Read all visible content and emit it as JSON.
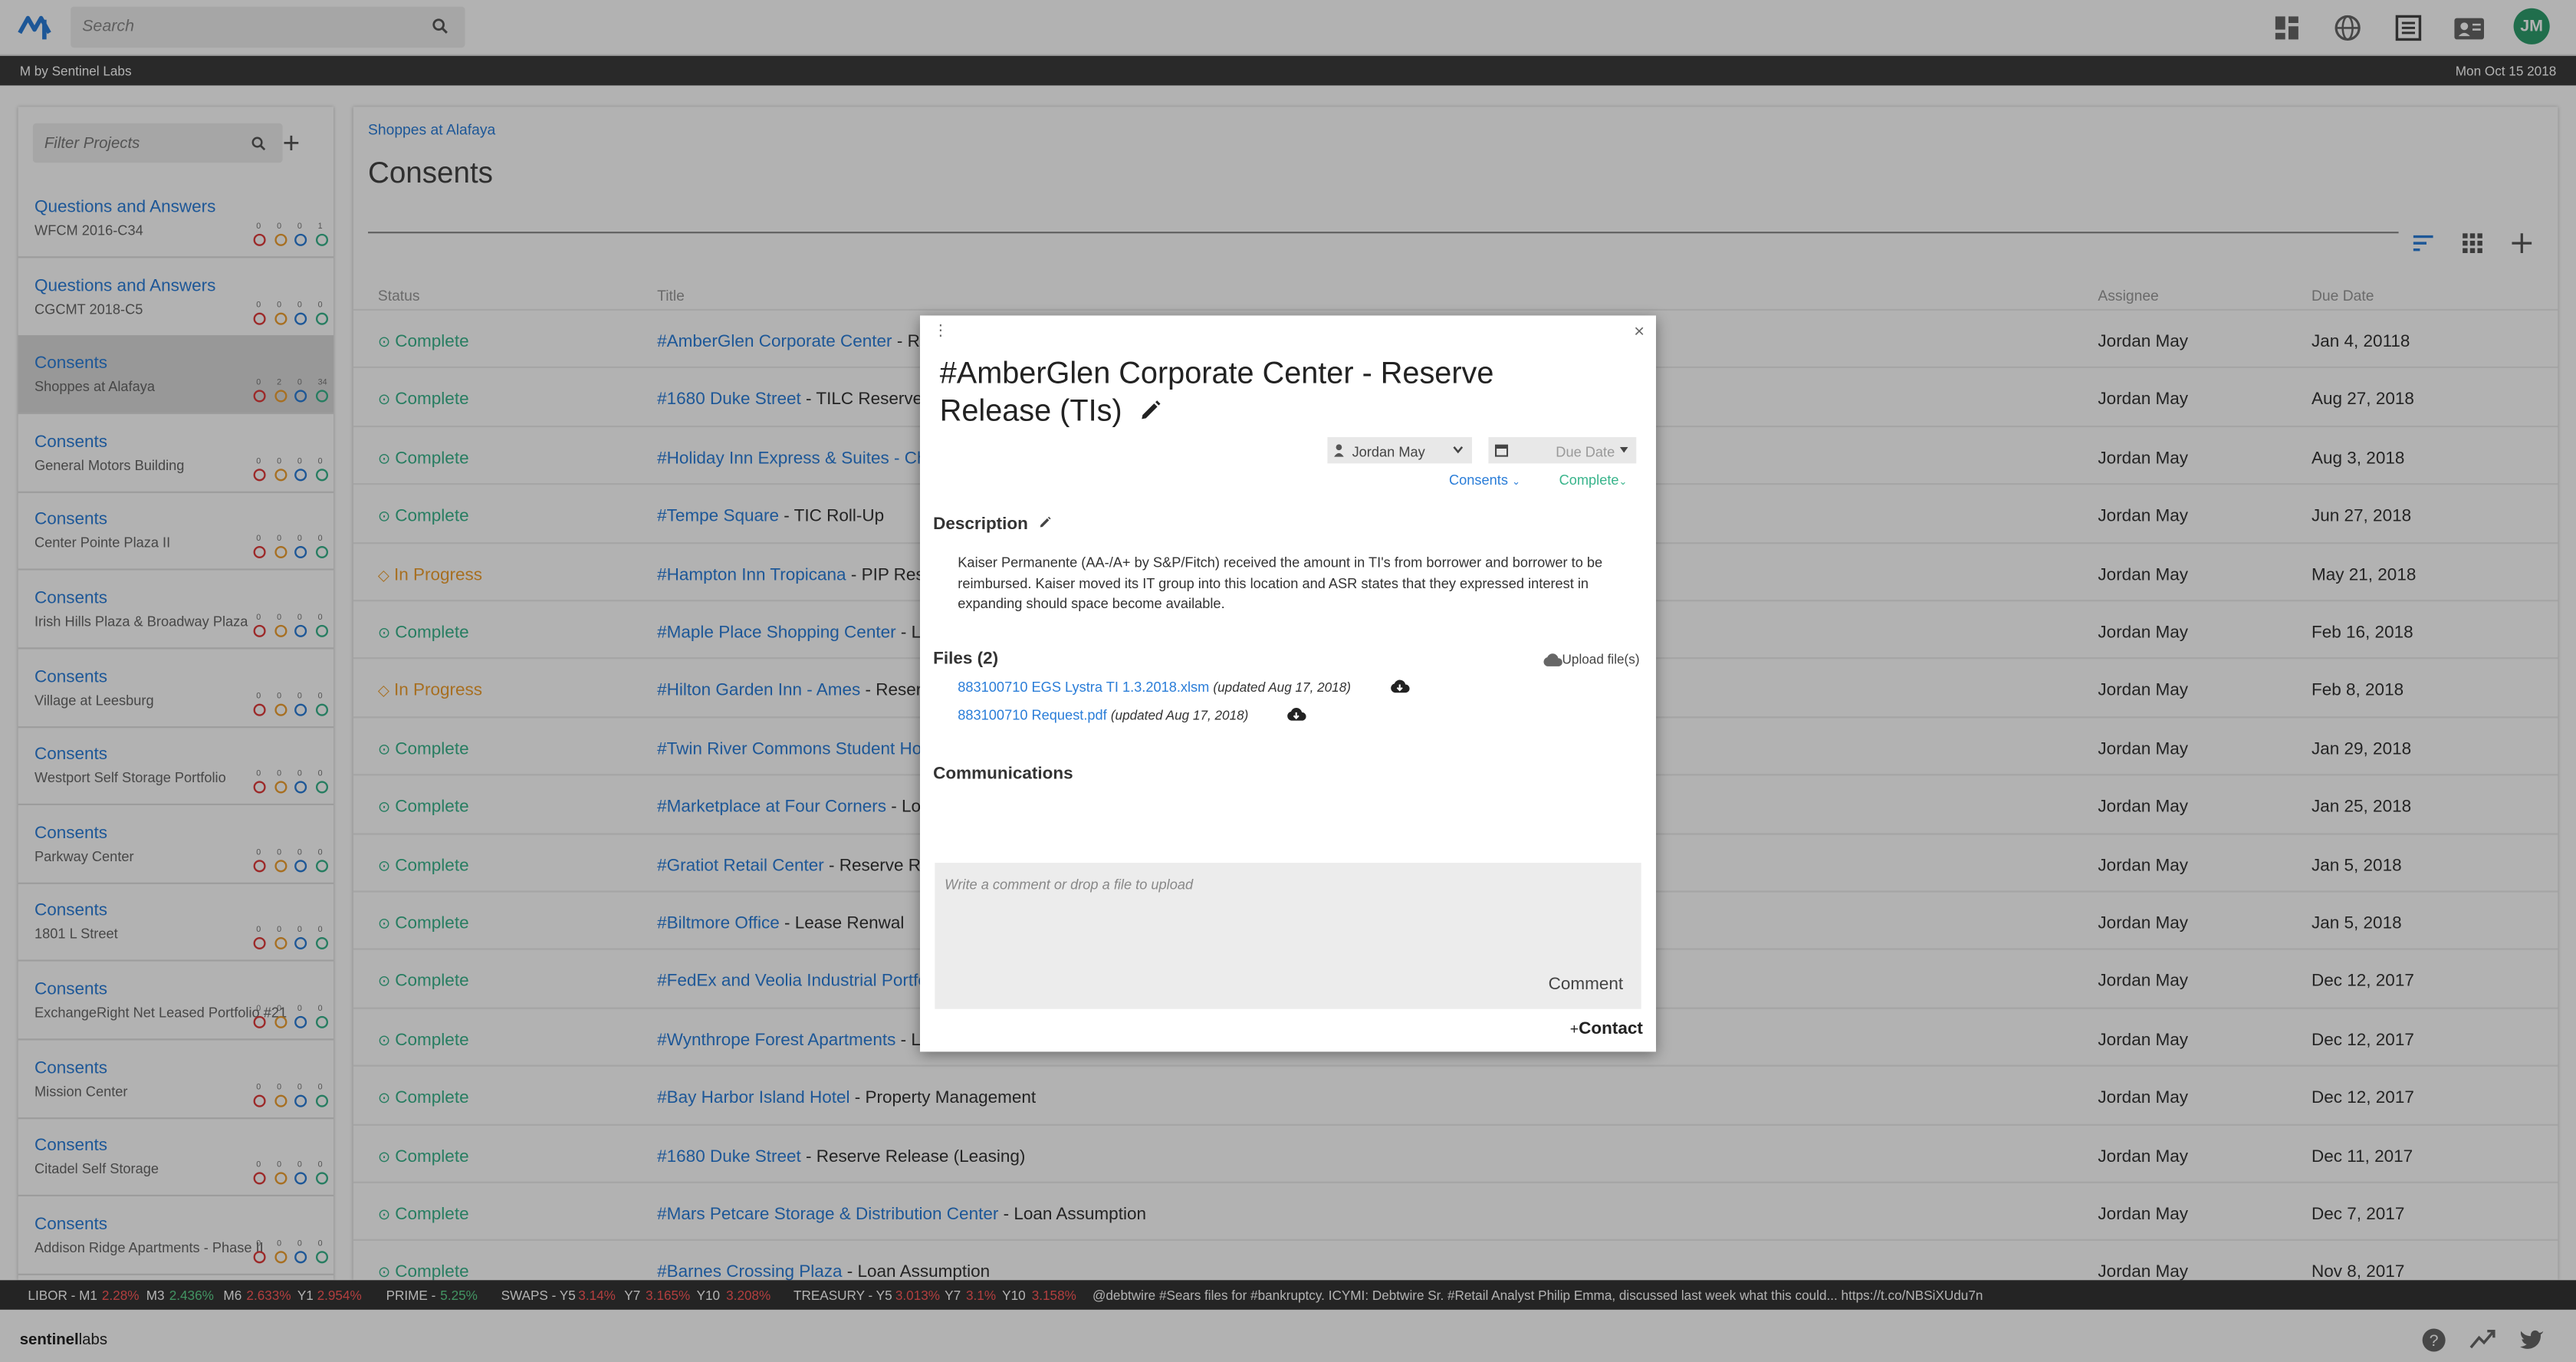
{
  "header": {
    "search_placeholder": "Search",
    "avatar_initials": "JM",
    "icons": [
      "dashboard-icon",
      "globe-icon",
      "list-icon",
      "contact-card-icon"
    ]
  },
  "infobar": {
    "app_name": "M by Sentinel Labs",
    "date": "Mon Oct 15 2018"
  },
  "sidebar": {
    "filter_placeholder": "Filter Projects",
    "items": [
      {
        "title": "Questions and Answers",
        "subtitle": "WFCM 2016-C34",
        "counts": [
          "0",
          "0",
          "0",
          "1"
        ]
      },
      {
        "title": "Questions and Answers",
        "subtitle": "CGCMT 2018-C5",
        "counts": [
          "0",
          "0",
          "0",
          "0"
        ]
      },
      {
        "title": "Consents",
        "subtitle": "Shoppes at Alafaya",
        "counts": [
          "0",
          "2",
          "0",
          "34"
        ],
        "selected": true
      },
      {
        "title": "Consents",
        "subtitle": "General Motors Building",
        "counts": [
          "0",
          "0",
          "0",
          "0"
        ]
      },
      {
        "title": "Consents",
        "subtitle": "Center Pointe Plaza II",
        "counts": [
          "0",
          "0",
          "0",
          "0"
        ]
      },
      {
        "title": "Consents",
        "subtitle": "Irish Hills Plaza & Broadway Plaza",
        "counts": [
          "0",
          "0",
          "0",
          "0"
        ]
      },
      {
        "title": "Consents",
        "subtitle": "Village at Leesburg",
        "counts": [
          "0",
          "0",
          "0",
          "0"
        ]
      },
      {
        "title": "Consents",
        "subtitle": "Westport Self Storage Portfolio",
        "counts": [
          "0",
          "0",
          "0",
          "0"
        ]
      },
      {
        "title": "Consents",
        "subtitle": "Parkway Center",
        "counts": [
          "0",
          "0",
          "0",
          "0"
        ]
      },
      {
        "title": "Consents",
        "subtitle": "1801 L Street",
        "counts": [
          "0",
          "0",
          "0",
          "0"
        ]
      },
      {
        "title": "Consents",
        "subtitle": "ExchangeRight Net Leased Portfolio #21",
        "counts": [
          "0",
          "0",
          "0",
          "0"
        ]
      },
      {
        "title": "Consents",
        "subtitle": "Mission Center",
        "counts": [
          "0",
          "0",
          "0",
          "0"
        ]
      },
      {
        "title": "Consents",
        "subtitle": "Citadel Self Storage",
        "counts": [
          "0",
          "0",
          "0",
          "0"
        ]
      },
      {
        "title": "Consents",
        "subtitle": "Addison Ridge Apartments - Phase II",
        "counts": [
          "0",
          "0",
          "0",
          "0"
        ]
      }
    ]
  },
  "main": {
    "breadcrumb": "Shoppes at Alafaya",
    "title": "Consents",
    "columns": {
      "status": "Status",
      "title": "Title",
      "assignee": "Assignee",
      "due_date": "Due Date"
    },
    "rows": [
      {
        "status": "Complete",
        "state": "c",
        "link": "#AmberGlen Corporate Center",
        "rest": " - Re",
        "assignee": "Jordan May",
        "due": "Jan 4, 20118"
      },
      {
        "status": "Complete",
        "state": "c",
        "link": "#1680 Duke Street",
        "rest": " - TILC Reserve F",
        "assignee": "Jordan May",
        "due": "Aug 27, 2018"
      },
      {
        "status": "Complete",
        "state": "c",
        "link": "#Holiday Inn Express & Suites - Ch",
        "rest": "",
        "assignee": "Jordan May",
        "due": "Aug 3, 2018"
      },
      {
        "status": "Complete",
        "state": "c",
        "link": "#Tempe Square",
        "rest": " - TIC Roll-Up",
        "assignee": "Jordan May",
        "due": "Jun 27, 2018"
      },
      {
        "status": "In Progress",
        "state": "p",
        "link": "#Hampton Inn Tropicana",
        "rest": " - PIP Res",
        "assignee": "Jordan May",
        "due": "May 21, 2018"
      },
      {
        "status": "Complete",
        "state": "c",
        "link": "#Maple Place Shopping Center",
        "rest": " - Lo",
        "assignee": "Jordan May",
        "due": "Feb 16, 2018"
      },
      {
        "status": "In Progress",
        "state": "p",
        "link": "#Hilton Garden Inn - Ames",
        "rest": " - Reser",
        "assignee": "Jordan May",
        "due": "Feb 8, 2018"
      },
      {
        "status": "Complete",
        "state": "c",
        "link": "#Twin River Commons Student Ho",
        "rest": "",
        "assignee": "Jordan May",
        "due": "Jan 29, 2018"
      },
      {
        "status": "Complete",
        "state": "c",
        "link": "#Marketplace at Four Corners",
        "rest": " - Loa",
        "assignee": "Jordan May",
        "due": "Jan 25, 2018"
      },
      {
        "status": "Complete",
        "state": "c",
        "link": "#Gratiot Retail Center",
        "rest": " - Reserve Re",
        "assignee": "Jordan May",
        "due": "Jan 5, 2018"
      },
      {
        "status": "Complete",
        "state": "c",
        "link": "#Biltmore Office",
        "rest": " - Lease Renwal",
        "assignee": "Jordan May",
        "due": "Jan 5, 2018"
      },
      {
        "status": "Complete",
        "state": "c",
        "link": "#FedEx and Veolia Industrial Portfo",
        "rest": "",
        "assignee": "Jordan May",
        "due": "Dec 12, 2017"
      },
      {
        "status": "Complete",
        "state": "c",
        "link": "#Wynthrope Forest Apartments",
        "rest": " - L",
        "assignee": "Jordan May",
        "due": "Dec 12, 2017"
      },
      {
        "status": "Complete",
        "state": "c",
        "link": "#Bay Harbor Island Hotel",
        "rest": " - Property Management",
        "assignee": "Jordan May",
        "due": "Dec 12, 2017"
      },
      {
        "status": "Complete",
        "state": "c",
        "link": "#1680 Duke Street",
        "rest": " - Reserve Release (Leasing)",
        "assignee": "Jordan May",
        "due": "Dec 11, 2017"
      },
      {
        "status": "Complete",
        "state": "c",
        "link": "#Mars Petcare Storage & Distribution Center",
        "rest": " - Loan Assumption",
        "assignee": "Jordan May",
        "due": "Dec 7, 2017"
      },
      {
        "status": "Complete",
        "state": "c",
        "link": "#Barnes Crossing Plaza",
        "rest": " - Loan Assumption",
        "assignee": "Jordan May",
        "due": "Nov 8, 2017"
      }
    ]
  },
  "ticker": {
    "libor_label": "LIBOR - M1",
    "m1": "2.28%",
    "m3_label": "M3",
    "m3": "2.436%",
    "m6_label": "M6",
    "m6": "2.633%",
    "y1_label": "Y1",
    "y1": "2.954%",
    "prime_label": "PRIME -",
    "prime": "5.25%",
    "swaps_label": "SWAPS - Y5",
    "swaps_y5": "3.14%",
    "swaps_y7_label": "Y7",
    "swaps_y7": "3.165%",
    "swaps_y10_label": "Y10",
    "swaps_y10": "3.208%",
    "treasury_label": "TREASURY - Y5",
    "tr_y5": "3.013%",
    "tr_y7_label": "Y7",
    "tr_y7": "3.1%",
    "tr_y10_label": "Y10",
    "tr_y10": "3.158%",
    "news": "@debtwire #Sears files for #bankruptcy. ICYMI: Debtwire Sr. #Retail Analyst Philip Emma, discussed last week what this could... https://t.co/NBSiXUdu7n"
  },
  "footer": {
    "brand_bold": "sentinel",
    "brand_light": "labs"
  },
  "modal": {
    "title": "#AmberGlen Corporate Center - Reserve Release (TIs)",
    "assignee": "Jordan May",
    "due_placeholder": "Due Date",
    "type": "Consents",
    "status": "Complete",
    "description_heading": "Description",
    "description": "Kaiser Permanente (AA-/A+ by S&P/Fitch) received the amount in TI's from borrower and borrower to be reimbursed. Kaiser moved its IT group into this location and ASR states that they expressed interest in expanding should space become available.",
    "files_heading": "Files (2)",
    "upload_label": "Upload file(s)",
    "files": [
      {
        "name": "883100710 EGS Lystra TI 1.3.2018.xlsm",
        "updated": "(updated Aug 17, 2018)"
      },
      {
        "name": "883100710 Request.pdf",
        "updated": "(updated Aug 17, 2018)"
      }
    ],
    "communications_heading": "Communications",
    "comment_placeholder": "Write a comment or drop a file to upload",
    "comment_button": "Comment",
    "contact_label": "Contact"
  }
}
